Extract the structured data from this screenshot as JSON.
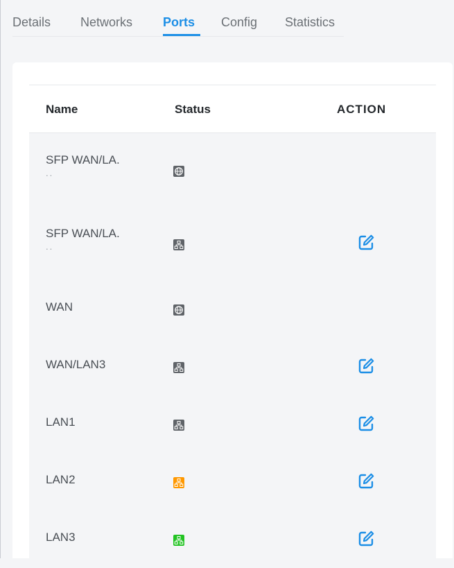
{
  "tabs": [
    {
      "label": "Details",
      "active": false
    },
    {
      "label": "Networks",
      "active": false
    },
    {
      "label": "Ports",
      "active": true
    },
    {
      "label": "Config",
      "active": false
    },
    {
      "label": "Statistics",
      "active": false
    }
  ],
  "table": {
    "headers": {
      "name": "Name",
      "status": "Status",
      "action": "ACTION"
    },
    "rows": [
      {
        "name": "SFP WAN/LA.",
        "name_overflow": "..",
        "status_icon": "globe-icon",
        "status_color": "#5f6368",
        "editable": false
      },
      {
        "name": "SFP WAN/LA.",
        "name_overflow": "..",
        "status_icon": "network-icon",
        "status_color": "#5f6368",
        "editable": true
      },
      {
        "name": "WAN",
        "name_overflow": "",
        "status_icon": "globe-icon",
        "status_color": "#5f6368",
        "editable": false
      },
      {
        "name": "WAN/LAN3",
        "name_overflow": "",
        "status_icon": "network-icon",
        "status_color": "#5f6368",
        "editable": true
      },
      {
        "name": "LAN1",
        "name_overflow": "",
        "status_icon": "network-icon",
        "status_color": "#5f6368",
        "editable": true
      },
      {
        "name": "LAN2",
        "name_overflow": "",
        "status_icon": "network-icon",
        "status_color": "#ff9800",
        "editable": true
      },
      {
        "name": "LAN3",
        "name_overflow": "",
        "status_icon": "network-icon",
        "status_color": "#22c322",
        "editable": true
      }
    ]
  },
  "colors": {
    "accent": "#1b8ee6",
    "row_background": "#f4f5f7",
    "icon_gray": "#5f6368",
    "status_orange": "#ff9800",
    "status_green": "#22c322"
  }
}
